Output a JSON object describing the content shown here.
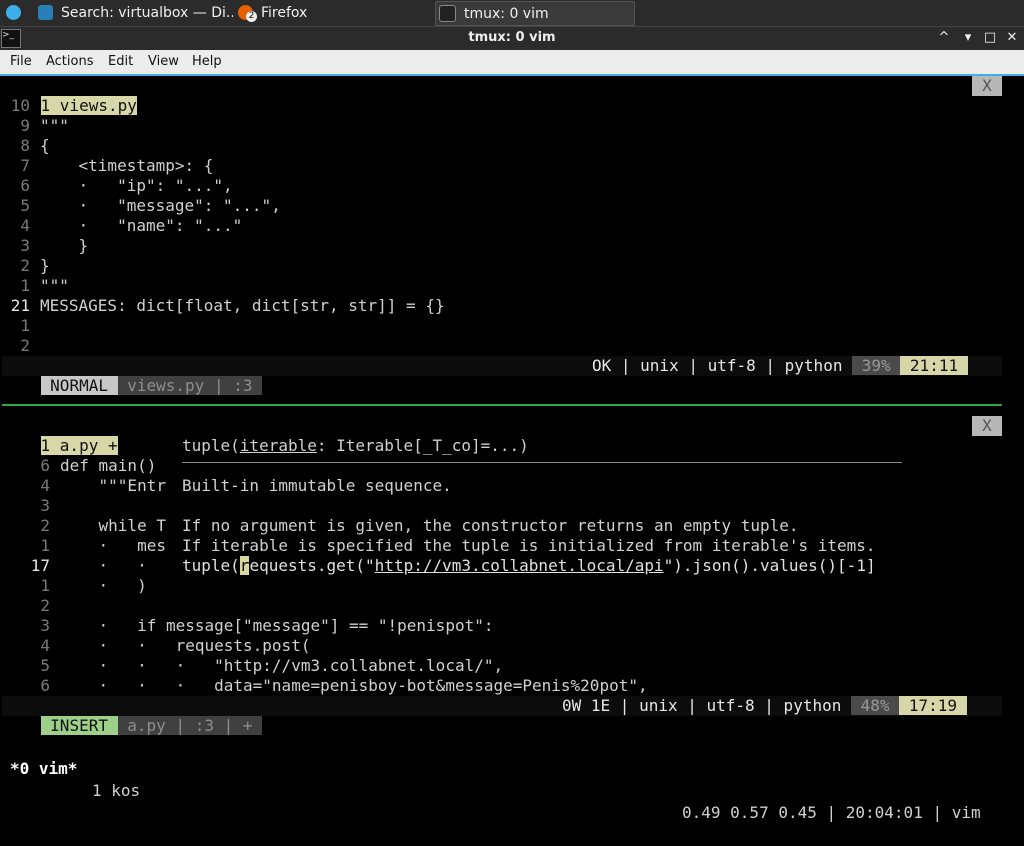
{
  "taskbar": {
    "tasks": [
      {
        "label": "Search: virtualbox — Di..."
      },
      {
        "label": "Firefox",
        "badge": "2"
      },
      {
        "label": "tmux: 0 vim"
      }
    ]
  },
  "window": {
    "title": "tmux: 0 vim",
    "minimize": "^",
    "restore": "▾",
    "maximize": "□",
    "close": "✕"
  },
  "menu": [
    "File",
    "Actions",
    "Edit",
    "View",
    "Help"
  ],
  "top_pane": {
    "tab_label": "1 views.py",
    "close_label": "X",
    "lines": [
      {
        "ln": "10",
        "text": ""
      },
      {
        "ln": " 9",
        "text": "\"\"\""
      },
      {
        "ln": " 8",
        "text": "{"
      },
      {
        "ln": " 7",
        "text": "    <timestamp>: {"
      },
      {
        "ln": " 6",
        "text": "    ·   \"ip\": \"...\","
      },
      {
        "ln": " 5",
        "text": "    ·   \"message\": \"...\","
      },
      {
        "ln": " 4",
        "text": "    ·   \"name\": \"...\""
      },
      {
        "ln": " 3",
        "text": "    }"
      },
      {
        "ln": " 2",
        "text": "}"
      },
      {
        "ln": " 1",
        "text": "\"\"\""
      },
      {
        "ln": "21",
        "text": "MESSAGES: dict[float, dict[str, str]] = {}"
      },
      {
        "ln": " 1",
        "text": ""
      },
      {
        "ln": " 2",
        "text": ""
      }
    ],
    "status": {
      "mode": "NORMAL",
      "file": "views.py",
      "line_seg": ":3",
      "info": "OK | unix | utf-8 | python",
      "percent": "39%",
      "position": "21:11"
    }
  },
  "bottom_pane": {
    "tab_label": "1 a.py +",
    "close_label": "X",
    "lines": [
      {
        "ln": "6",
        "text": "def main()"
      },
      {
        "ln": "4",
        "text": "    \"\"\"Entr"
      },
      {
        "ln": "3",
        "text": ""
      },
      {
        "ln": "2",
        "text": "    while T"
      },
      {
        "ln": "1",
        "text": "    ·   mes"
      },
      {
        "ln": "17",
        "text": "    ·   ·   "
      },
      {
        "ln": "1",
        "text": "    ·   )"
      },
      {
        "ln": "2",
        "text": ""
      },
      {
        "ln": "3",
        "text": "    ·   if message[\"message\"] == \"!penispot\":"
      },
      {
        "ln": "4",
        "text": "    ·   ·   requests.post("
      },
      {
        "ln": "5",
        "text": "    ·   ·   ·   \"http://vm3.collabnet.local/\","
      },
      {
        "ln": "6",
        "text": "    ·   ·   ·   data=\"name=penisboy-bot&message=Penis%20pot\","
      }
    ],
    "popup": {
      "signature_name": "tuple(",
      "signature_param": "iterable",
      "signature_rest": ": Iterable[_T_co]=...)",
      "doc1": "Built-in immutable sequence.",
      "doc2": "If no argument is given, the constructor returns an empty tuple.",
      "doc3": "If iterable is specified the tuple is initialized from iterable's items."
    },
    "cursor_line": {
      "prefix": "tuple(",
      "cursor_char": "r",
      "rest_a": "equests.get(\"",
      "url": "http://vm3.collabnet.local/api",
      "rest_b": "\").json().values()[-1]"
    },
    "status": {
      "mode": "INSERT",
      "file": "a.py",
      "line_seg": ":3",
      "modified": "+",
      "info": "0W 1E | unix | utf-8 | python",
      "percent": "48%",
      "position": "17:19"
    }
  },
  "tmux": {
    "window": "*0 vim*",
    "session": "1 kos",
    "right": "0.49 0.57 0.45 | 20:04:01 | vim"
  }
}
